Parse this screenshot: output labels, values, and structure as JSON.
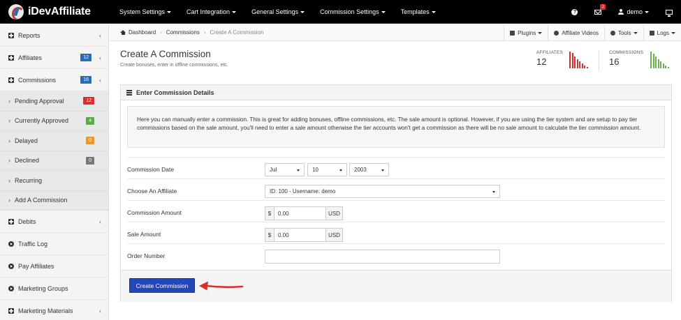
{
  "app": {
    "brand": "iDevAffiliate"
  },
  "topnav": {
    "items": [
      {
        "label": "System Settings"
      },
      {
        "label": "Cart Integration"
      },
      {
        "label": "General Settings"
      },
      {
        "label": "Commission Settings"
      },
      {
        "label": "Templates"
      }
    ],
    "help_glyph": "?",
    "mail_badge": "1",
    "user": "demo"
  },
  "sidebar": {
    "items": [
      {
        "label": "Reports"
      },
      {
        "label": "Affiliates",
        "badge": "12"
      },
      {
        "label": "Commissions",
        "badge": "16"
      }
    ],
    "sub_items": [
      {
        "label": "Pending Approval",
        "badge": "12",
        "color": "#d9302d"
      },
      {
        "label": "Currently Approved",
        "badge": "4",
        "color": "#5cab4a"
      },
      {
        "label": "Delayed",
        "badge": "0",
        "color": "#f0952a"
      },
      {
        "label": "Declined",
        "badge": "0",
        "color": "#777777"
      },
      {
        "label": "Recurring"
      },
      {
        "label": "Add A Commission"
      }
    ],
    "bottom_items": [
      {
        "label": "Debits"
      },
      {
        "label": "Traffic Log"
      },
      {
        "label": "Pay Affiliates"
      },
      {
        "label": "Marketing Groups"
      },
      {
        "label": "Marketing Materials"
      }
    ]
  },
  "breadcrumb": {
    "items": [
      "Dashboard",
      "Commissions",
      "Create A Commission"
    ],
    "tools": [
      "Plugins",
      "Affiliate Videos",
      "Tools",
      "Logs"
    ]
  },
  "page": {
    "title": "Create A Commission",
    "subtitle": "Create bonuses, enter in offline commissions, etc."
  },
  "stats": {
    "affiliates": {
      "label": "AFFILIATES",
      "value": "12",
      "color": "#d9302d",
      "bars": [
        22,
        20,
        16,
        12,
        9,
        6,
        4,
        2
      ]
    },
    "commissions": {
      "label": "COMMISSIONS",
      "value": "16",
      "color": "#6ab04c",
      "bars": [
        24,
        21,
        17,
        13,
        10,
        7,
        4,
        2
      ]
    }
  },
  "panel": {
    "title": "Enter Commission Details",
    "info": "Here you can manually enter a commission. This is great for adding bonuses, offline commissions, etc. The sale amount is optional. However, if you are using the tier system and are setup to pay tier commissions based on the sale amount, you'll need to enter a sale amount otherwise the tier accounts won't get a commission as there will be no sale amount to calculate the tier commission amount."
  },
  "form": {
    "date_label": "Commission Date",
    "month": "Jul",
    "day": "10",
    "year": "2003",
    "affiliate_label": "Choose An Affiliate",
    "affiliate_value": "ID: 100 - Username: demo",
    "commission_amount_label": "Commission Amount",
    "commission_amount": "0.00",
    "sale_amount_label": "Sale Amount",
    "sale_amount": "0.00",
    "currency_symbol": "$",
    "currency_code": "USD",
    "order_label": "Order Number",
    "order_value": ""
  },
  "actions": {
    "submit": "Create Commission",
    "arrow_color": "#d9302d"
  }
}
